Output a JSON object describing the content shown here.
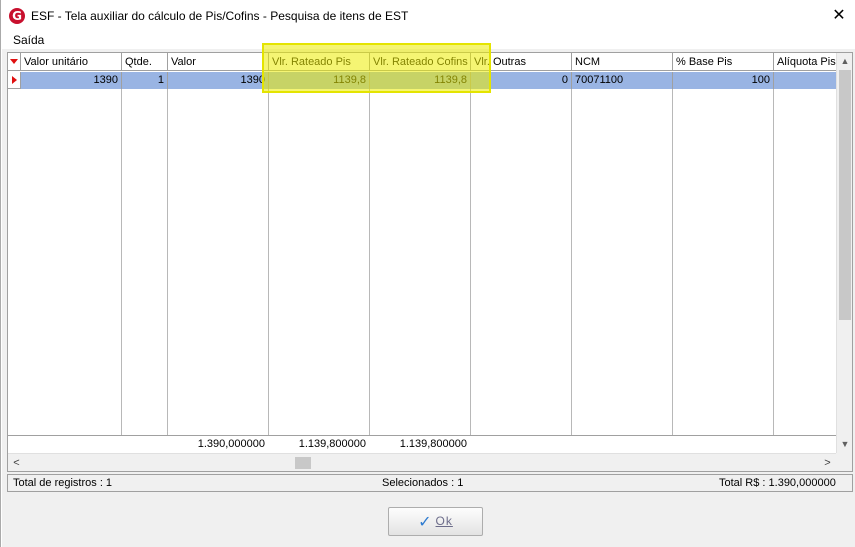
{
  "window": {
    "title": "ESF - Tela auxiliar do cálculo de Pis/Cofins - Pesquisa de itens de EST",
    "icon_letter": "G",
    "close_glyph": "✕"
  },
  "menu": {
    "items": [
      "Saída"
    ]
  },
  "grid": {
    "columns": [
      "Valor unitário",
      "Qtde.",
      "Valor",
      "Vlr. Rateado Pis",
      "Vlr. Rateado Cofins",
      "Vlr. Outras",
      "NCM",
      "% Base Pis",
      "Alíquota Pis"
    ],
    "rows": [
      [
        "1390",
        "1",
        "1390",
        "1139,8",
        "1139,8",
        "0",
        "70071100",
        "100",
        ""
      ]
    ],
    "footer_totals": {
      "valor": "1.390,000000",
      "rateado_pis": "1.139,800000",
      "rateado_cofins": "1.139,800000"
    },
    "selected_row": 0
  },
  "status": {
    "total_registros": "Total de registros :  1",
    "selecionados": "Selecionados :  1",
    "total_rs": "Total R$ :  1.390,000000"
  },
  "buttons": {
    "ok_label": "Ok",
    "ok_icon": "check-icon"
  },
  "colors": {
    "selection_row": "#99b4e3",
    "highlight": "#ecec00",
    "indicator": "#e01010",
    "icon_brand": "#c8102e"
  }
}
